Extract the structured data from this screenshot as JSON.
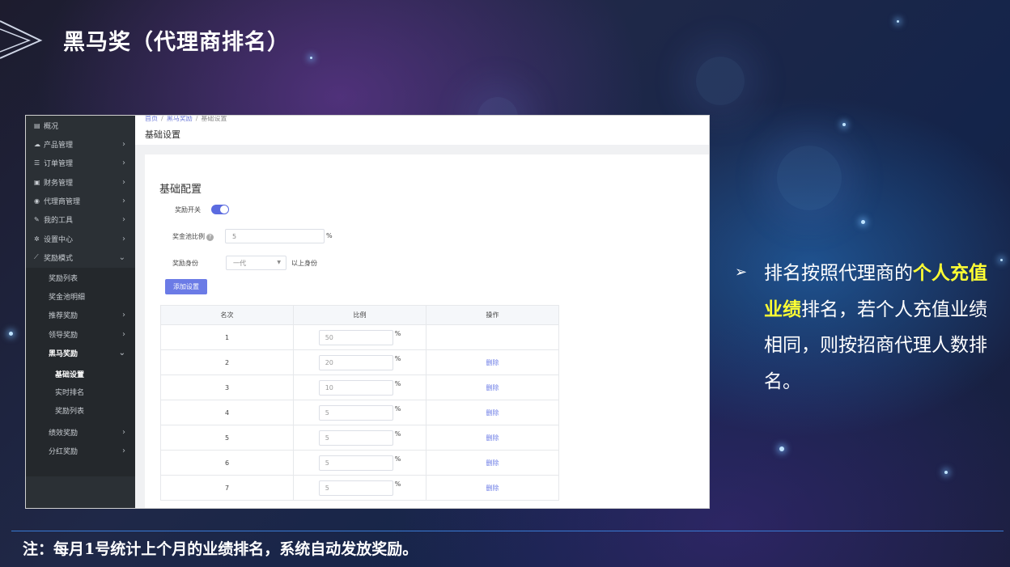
{
  "slide": {
    "title": "黑马奖（代理商排名）",
    "description_parts": {
      "p1": "排名按照代理商的",
      "highlight": "个人充值业绩",
      "p2": "排名，若个人充值业绩相同，则按招商代理人数排名。"
    },
    "note": "注：每月1号统计上个月的业绩排名，系统自动发放奖励。",
    "highlight_color": "#ffff33"
  },
  "sidebar": {
    "items": [
      {
        "label": "概况",
        "icon": "dashboard-icon"
      },
      {
        "label": "产品管理",
        "icon": "cloud-icon"
      },
      {
        "label": "订单管理",
        "icon": "list-icon"
      },
      {
        "label": "财务管理",
        "icon": "wallet-icon"
      },
      {
        "label": "代理商管理",
        "icon": "users-icon"
      },
      {
        "label": "我的工具",
        "icon": "wrench-icon"
      },
      {
        "label": "设置中心",
        "icon": "gear-icon"
      },
      {
        "label": "奖励模式",
        "icon": "chart-icon"
      }
    ],
    "sub_items": [
      "奖励列表",
      "奖金池明细",
      "推荐奖励",
      "领导奖励",
      "黑马奖励"
    ],
    "heima_sub": [
      "基础设置",
      "实时排名",
      "奖励列表"
    ],
    "bottom_items": [
      "绩效奖励",
      "分红奖励"
    ]
  },
  "breadcrumb": {
    "home": "首页",
    "section": "黑马奖励",
    "current": "基础设置"
  },
  "page_heading": "基础设置",
  "form": {
    "card_title": "基础配置",
    "switch_label": "奖励开关",
    "switch_on": true,
    "pool_label": "奖金池比例",
    "pool_value": "5",
    "pool_unit": "%",
    "identity_label": "奖励身份",
    "identity_value": "一代",
    "identity_suffix": "以上身份",
    "add_button": "添加设置"
  },
  "table": {
    "headers": [
      "名次",
      "比例",
      "操作"
    ],
    "unit": "%",
    "delete_label": "删除",
    "rows": [
      {
        "rank": "1",
        "ratio": "50",
        "deletable": false
      },
      {
        "rank": "2",
        "ratio": "20",
        "deletable": true
      },
      {
        "rank": "3",
        "ratio": "10",
        "deletable": true
      },
      {
        "rank": "4",
        "ratio": "5",
        "deletable": true
      },
      {
        "rank": "5",
        "ratio": "5",
        "deletable": true
      },
      {
        "rank": "6",
        "ratio": "5",
        "deletable": true
      },
      {
        "rank": "7",
        "ratio": "5",
        "deletable": true
      }
    ]
  }
}
